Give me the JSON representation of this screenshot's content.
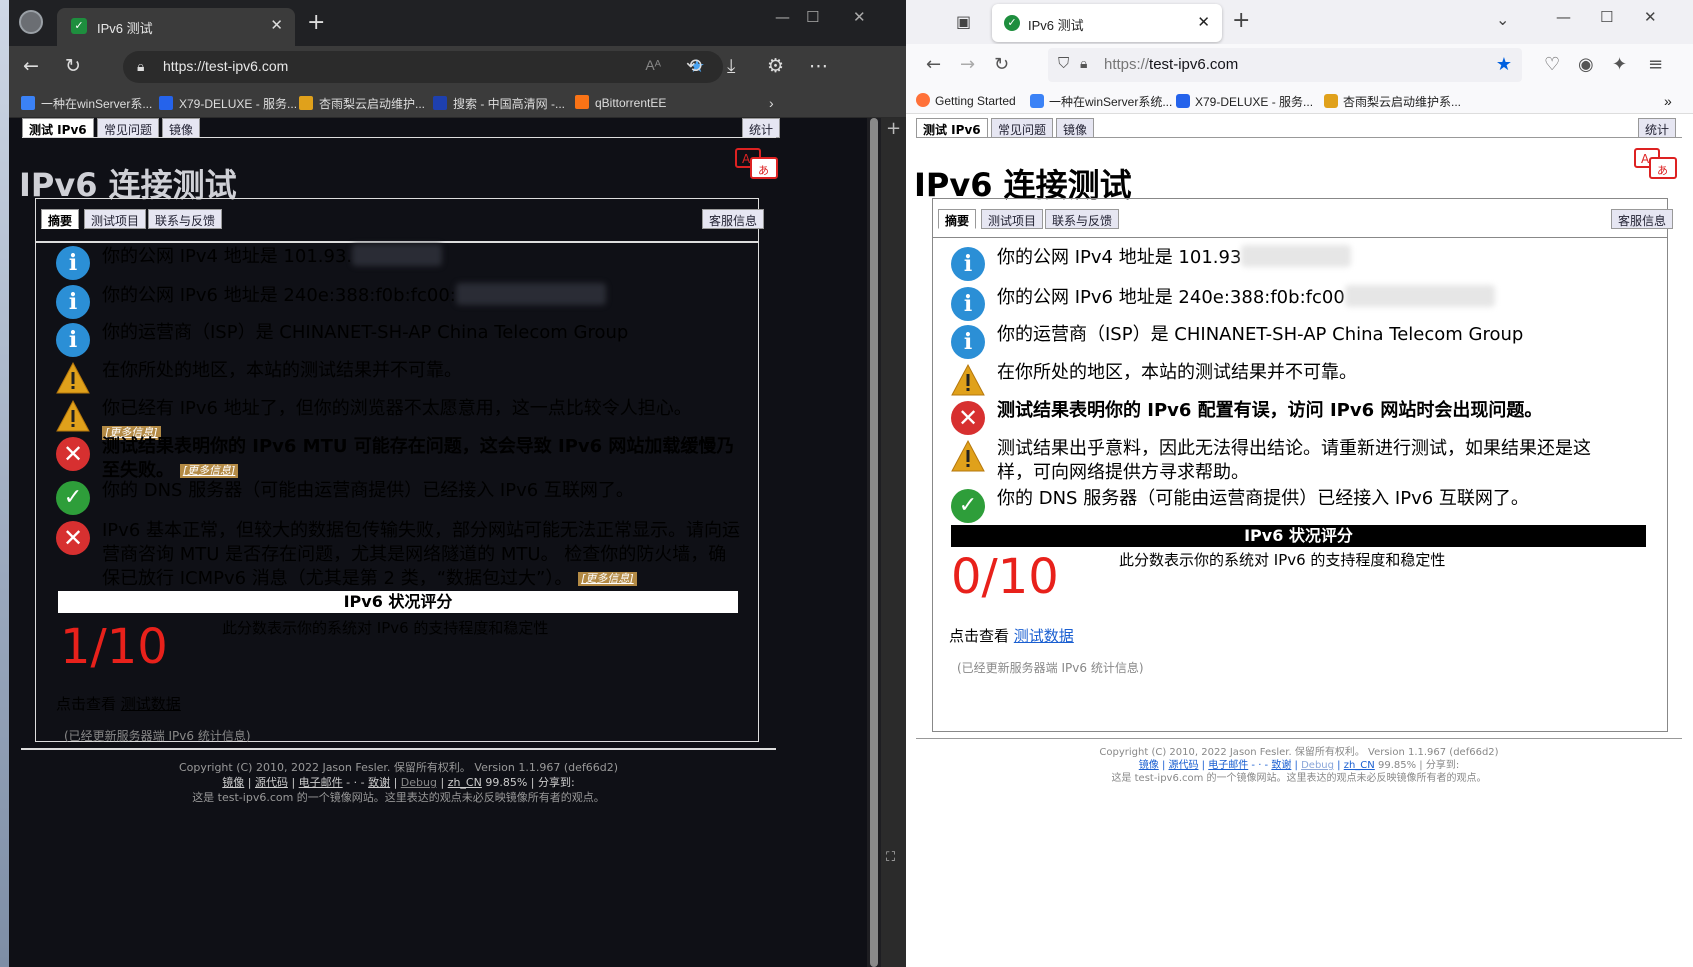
{
  "edge": {
    "tab_title": "IPv6 测试",
    "url": "https://test-ipv6.com",
    "bookmarks": [
      "一种在winServer系...",
      "X79-DELUXE - 服务...",
      "杏雨梨云启动维护...",
      "搜索 - 中国高清网 -...",
      "qBittorrentEE"
    ]
  },
  "firefox": {
    "tab_title": "IPv6 测试",
    "url_prefix": "https://",
    "url_host": "test-ipv6.com",
    "bookmarks": [
      "Getting Started",
      "一种在winServer系统...",
      "X79-DELUXE - 服务...",
      "杏雨梨云启动维护系..."
    ]
  },
  "site": {
    "top_tabs": [
      "测试 IPv6",
      "常见问题",
      "镜像"
    ],
    "stats_tab": "统计",
    "title": "IPv6 连接测试",
    "sub_tabs": [
      "摘要",
      "测试项目",
      "联系与反馈"
    ],
    "help_tab": "客服信息",
    "more_info": "[更多信息]",
    "score_header": "IPv6 状况评分",
    "score_desc": "此分数表示你的系统对 IPv6 的支持程度和稳定性",
    "view_label": "点击查看",
    "view_link": "测试数据",
    "updated": "(已经更新服务器端 IPv6 统计信息)",
    "footer_line1": "Copyright (C) 2010, 2022 Jason Fesler. 保留所有权利。 Version 1.1.967 (def66d2)",
    "footer_links": [
      "镜像",
      "源代码",
      "电子邮件",
      "致谢",
      "Debug",
      "zh_CN"
    ],
    "footer_pct": "99.85%",
    "footer_share": "分享到:",
    "footer_line3": "这是 test-ipv6.com 的一个镜像网站。这里表达的观点未必反映镜像所有者的观点。"
  },
  "edge_results": [
    {
      "icon": "info",
      "text": "你的公网 IPv4 地址是 101.93."
    },
    {
      "icon": "info",
      "text": "你的公网 IPv6 地址是 240e:388:f0b:fc00:"
    },
    {
      "icon": "info",
      "text": "你的运营商（ISP）是 CHINANET-SH-AP China Telecom Group"
    },
    {
      "icon": "warn",
      "text": "在你所处的地区，本站的测试结果并不可靠。"
    },
    {
      "icon": "warn",
      "text": "你已经有 IPv6 地址了，但你的浏览器不太愿意用，这一点比较令人担心。"
    },
    {
      "icon": "err",
      "text": "测试结果表明你的 IPv6 MTU 可能存在问题，这会导致 IPv6 网站加载缓慢乃至失败。"
    },
    {
      "icon": "ok",
      "text": "你的 DNS 服务器（可能由运营商提供）已经接入 IPv6 互联网了。"
    },
    {
      "icon": "err",
      "text": "IPv6 基本正常，但较大的数据包传输失败，部分网站可能无法正常显示。请向运营商咨询 MTU 是否存在问题，尤其是网络隧道的 MTU。 检查你的防火墙，确保已放行 ICMPv6 消息（尤其是第 2 类，“数据包过大”）。"
    }
  ],
  "edge_score": "1/10",
  "ff_results": [
    {
      "icon": "info",
      "text": "你的公网 IPv4 地址是 101.93"
    },
    {
      "icon": "info",
      "text": "你的公网 IPv6 地址是 240e:388:f0b:fc00"
    },
    {
      "icon": "info",
      "text": "你的运营商（ISP）是 CHINANET-SH-AP China Telecom Group"
    },
    {
      "icon": "warn",
      "text": "在你所处的地区，本站的测试结果并不可靠。"
    },
    {
      "icon": "err",
      "text": "测试结果表明你的 IPv6 配置有误，访问 IPv6 网站时会出现问题。"
    },
    {
      "icon": "warn",
      "text": "测试结果出乎意料，因此无法得出结论。请重新进行测试，如果结果还是这样，可向网络提供方寻求帮助。"
    },
    {
      "icon": "ok",
      "text": "你的 DNS 服务器（可能由运营商提供）已经接入 IPv6 互联网了。"
    }
  ],
  "ff_score": "0/10",
  "colors": {
    "score": "#e8211b",
    "info": "#2b8fd6",
    "error": "#d73030",
    "ok": "#2e9e3a",
    "warn": "#e0a11b"
  }
}
